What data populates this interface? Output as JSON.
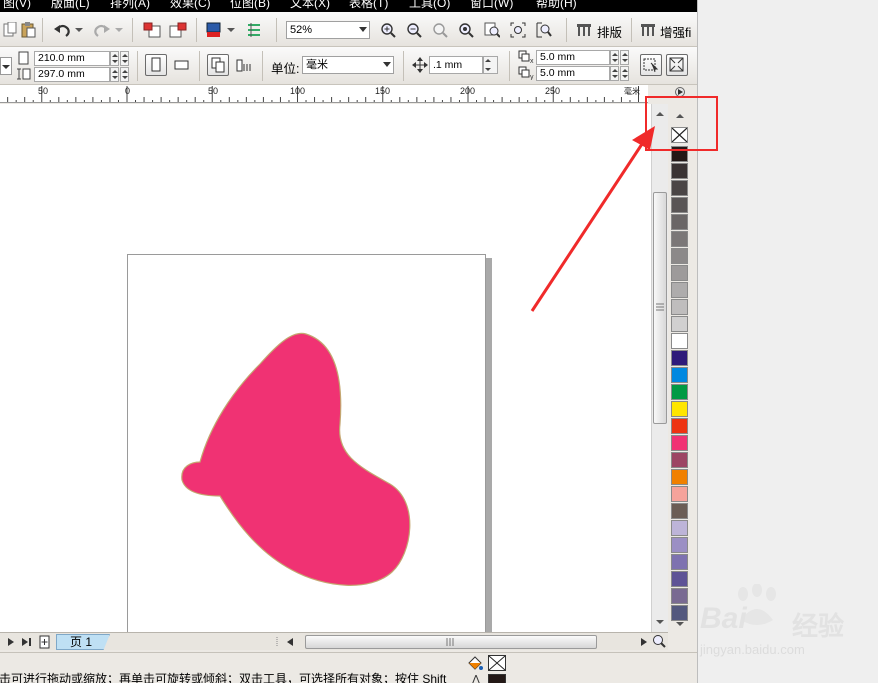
{
  "menu": [
    "图(V)",
    "版面(L)",
    "排列(A)",
    "效果(C)",
    "位图(B)",
    "文本(X)",
    "表格(T)",
    "工具(O)",
    "窗口(W)",
    "帮助(H)"
  ],
  "toolbar": {
    "zoom": "52%",
    "layout_label": "排版",
    "enhance_label": "增强fi"
  },
  "props": {
    "width": "210.0 mm",
    "height": "297.0 mm",
    "unit_label": "单位:",
    "unit_value": "毫米",
    "nudge": ".1 mm",
    "dup_x": "5.0 mm",
    "dup_y": "5.0 mm"
  },
  "ruler": {
    "labels": [
      "50",
      "0",
      "50",
      "100",
      "150",
      "200",
      "250"
    ],
    "unit": "毫米"
  },
  "page_nav": {
    "page_tab": "页 1"
  },
  "status": {
    "hint": "击可进行拖动或缩放；再单击可旋转或倾斜；双击工具，可选择所有对象；按住 Shift"
  },
  "palette": {
    "colors": [
      "#231816",
      "#3a3333",
      "#4a4545",
      "#595555",
      "#6a6666",
      "#7b7777",
      "#8c8989",
      "#9d9a9a",
      "#aeacac",
      "#bfbdbd",
      "#d1d0d0",
      "#ffffff",
      "#2e1a7a",
      "#0088e0",
      "#009a44",
      "#ffe600",
      "#ee3311",
      "#f03273",
      "#9c4463",
      "#f08000",
      "#f5a39b",
      "#6b5d55",
      "#bdb4d8",
      "#9b8fc4",
      "#7e72b0",
      "#5e5396",
      "#796a92",
      "#53587e"
    ]
  },
  "shape_color": "#f03273",
  "annotation_color": "#f02a2a",
  "watermark": {
    "brand": "Bai",
    "brand2": "经验",
    "url": "jingyan.baidu.com"
  }
}
